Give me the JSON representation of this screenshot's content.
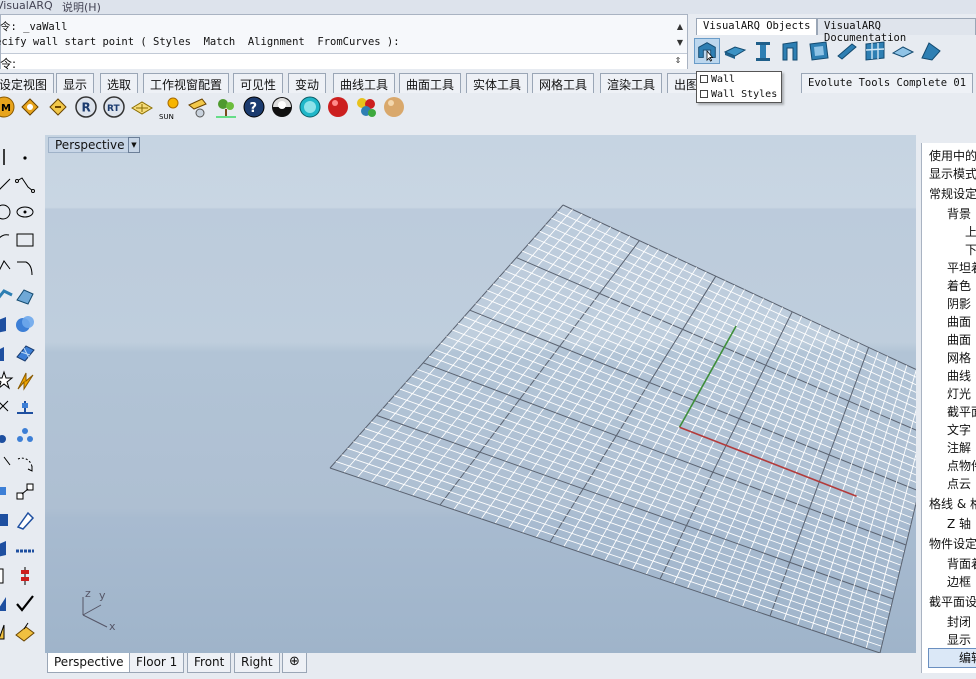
{
  "menubar": {
    "app": "VisualARQ",
    "help": "说明(H)"
  },
  "command": {
    "line1": "令: _vaWall",
    "line2": "ecify wall start point ( Styles  Match  Alignment  FromCurves ):",
    "prompt": "令:"
  },
  "visualarq": {
    "tabs": [
      "VisualARQ Objects",
      "VisualARQ Documentation"
    ],
    "icons": [
      "wall-icon",
      "slab-icon",
      "column-icon",
      "door-icon",
      "window-icon",
      "beam-icon",
      "curtain-wall-icon",
      "roof-icon",
      "stair-icon"
    ],
    "menu": [
      "Wall",
      "Wall Styles"
    ]
  },
  "toolbar_tabs": [
    "设定视图",
    "显示",
    "选取",
    "工作视窗配置",
    "可见性",
    "变动",
    "曲线工具",
    "曲面工具",
    "实体工具",
    "网格工具",
    "渲染工具",
    "出图",
    "Evolute Tools Complete 01"
  ],
  "toolbar_icons": [
    "material-icon",
    "tag-icon",
    "label-icon",
    "render-icon",
    "rt-icon",
    "ground-plane-icon",
    "sun-icon",
    "spotlight-icon",
    "plant-icon",
    "help-icon",
    "environment-icon",
    "texture-icon",
    "red-sphere-icon",
    "multi-sphere-icon",
    "beige-sphere-icon"
  ],
  "sun_label": "SUN",
  "viewport": {
    "name": "Perspective",
    "axis_labels": {
      "x": "x",
      "y": "y",
      "z": "z"
    }
  },
  "viewport_tabs": [
    "Perspective",
    "Floor 1",
    "Front",
    "Right"
  ],
  "right_panel": {
    "items": [
      "使用中的",
      "显示模式",
      "常规设定",
      "背景",
      "上",
      "下",
      "平坦着",
      "着色",
      "阴影",
      "曲面",
      "曲面",
      "网格",
      "曲线",
      "灯光",
      "截平面",
      "文字",
      "注解",
      "点物件",
      "点云",
      "格线 & 格",
      "Z 轴",
      "物件设定",
      "背面着",
      "边框",
      "截平面设",
      "封闭",
      "显示"
    ],
    "button": "编辑"
  },
  "colors": {
    "accent": "#6a9cc8",
    "y_axis": "#3e8e3a",
    "x_axis": "#b23b3b",
    "grid": "#ffffff"
  }
}
